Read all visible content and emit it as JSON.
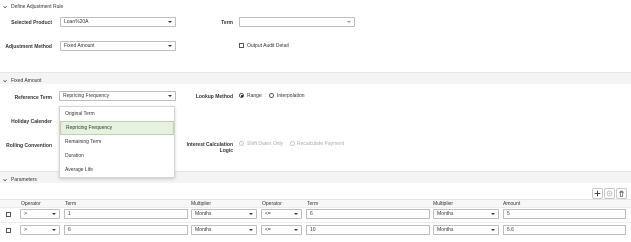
{
  "define_section": {
    "title": "Define Adjustment Rule",
    "selected_product_label": "Selected Product",
    "selected_product_value": "Loan%20A",
    "term_label": "Term",
    "term_value": "",
    "adjustment_method_label": "Adjustment Method",
    "adjustment_method_value": "Fixed Amount",
    "output_audit_label": "Output Audit Detail"
  },
  "fixed_section": {
    "title": "Fixed Amount",
    "reference_term_label": "Reference Term",
    "reference_term_value": "Repricing Frequency",
    "lookup_method_label": "Lookup Method",
    "lookup_options": [
      "Range",
      "Interpolation"
    ],
    "lookup_selected": "Range",
    "holiday_calendar_label": "Holiday Calender",
    "rolling_convention_label": "Rolling Convention",
    "interest_calc_label_1": "Interest Calculation",
    "interest_calc_label_2": "Logic",
    "interest_calc_options": [
      "Shift Dates Only",
      "Recalculate Payment"
    ],
    "dropdown_options": [
      "Original Term",
      "Repricing Frequency",
      "Remaining Term",
      "Duration",
      "Average Life"
    ],
    "dropdown_selected": "Repricing Frequency"
  },
  "parameters_section": {
    "title": "Parameters",
    "toolbar": {
      "add": "+",
      "copy": "⊙",
      "delete": "🗑"
    },
    "columns": [
      "Operator",
      "Term",
      "Multiplier",
      "Operator",
      "Term",
      "Multiplier",
      "Amount"
    ],
    "rows": [
      {
        "op1": ">",
        "term1": "1",
        "mult1": "Months",
        "op2": "<=",
        "term2": "6",
        "mult2": "Months",
        "amount": "5"
      },
      {
        "op1": ">",
        "term1": "6",
        "mult1": "Months",
        "op2": "<=",
        "term2": "10",
        "mult2": "Months",
        "amount": "5.6"
      }
    ]
  }
}
